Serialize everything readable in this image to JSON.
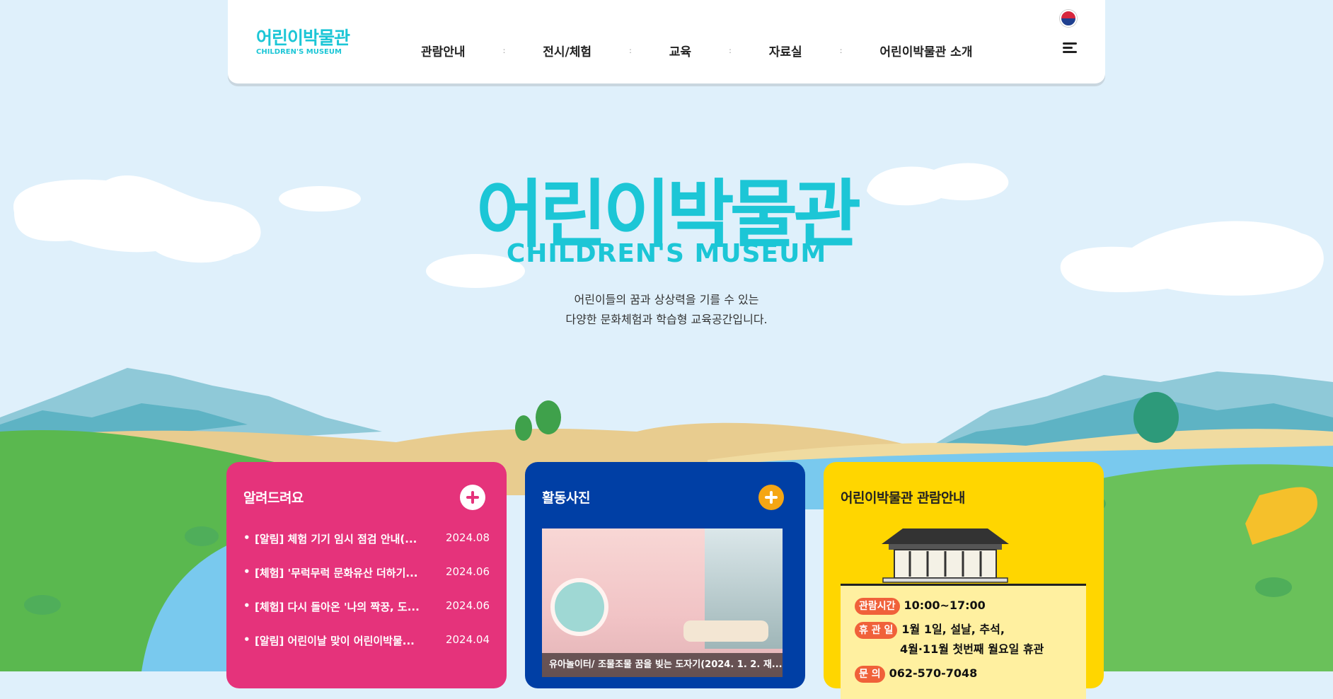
{
  "header": {
    "logo_ko": "어린이박물관",
    "logo_en": "CHILDREN'S MUSEUM",
    "nav": [
      "관람안내",
      "전시/체험",
      "교육",
      "자료실",
      "어린이박물관 소개"
    ],
    "flag_icon": "korea-flag-icon",
    "menu_icon": "menu-icon"
  },
  "hero": {
    "title_ko": "어린이박물관",
    "title_en": "CHILDREN'S MUSEUM",
    "desc_line1": "어린이들의 꿈과 상상력을 기를 수 있는",
    "desc_line2": "다양한 문화체험과 학습형 교육공간입니다."
  },
  "notice": {
    "title": "알려드려요",
    "more_icon": "plus-icon",
    "items": [
      {
        "title": "[알림] 체험 기기 임시 점검 안내(...",
        "date": "2024.08"
      },
      {
        "title": "[체험] '무럭무럭 문화유산 더하기...",
        "date": "2024.06"
      },
      {
        "title": "[체험] 다시 돌아온 '나의 짝꿍, 도...",
        "date": "2024.06"
      },
      {
        "title": "[알림] 어린이날 맞이 어린이박물...",
        "date": "2024.04"
      }
    ]
  },
  "photos": {
    "title": "활동사진",
    "more_icon": "plus-icon",
    "caption": "유아놀이터/ 조물조물 꿈을 빚는 도자기(2024. 1. 2. 재..."
  },
  "info": {
    "title": "어린이박물관 관람안내",
    "hours_label": "관람시간",
    "hours_value": "10:00~17:00",
    "closed_label": "휴 관 일",
    "closed_value1": "1월 1일, 설날, 추석,",
    "closed_value2": "4월·11월 첫번째 월요일 휴관",
    "contact_label": "문 의",
    "contact_value": "062-570-7048"
  },
  "colors": {
    "accent": "#1cc6d6",
    "notice_bg": "#e5337b",
    "photo_bg": "#003fa5",
    "info_bg": "#ffd600"
  }
}
